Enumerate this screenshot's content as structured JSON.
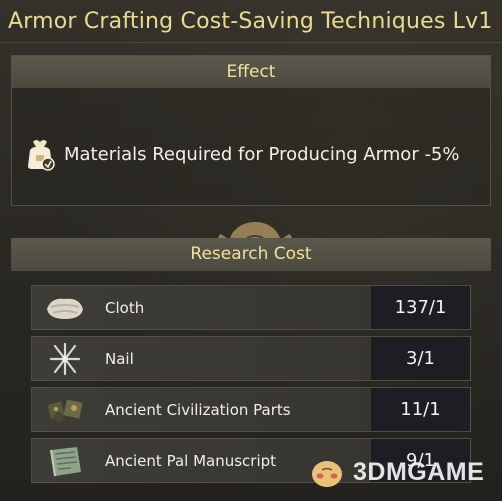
{
  "window": {
    "title": "Armor Crafting Cost-Saving Techniques Lv1"
  },
  "effect": {
    "heading": "Effect",
    "icon": "material-bag-icon",
    "text": "Materials Required for Producing Armor -5%"
  },
  "research_cost": {
    "heading": "Research Cost",
    "items": [
      {
        "icon": "cloth-icon",
        "name": "Cloth",
        "count": "137/1"
      },
      {
        "icon": "nail-icon",
        "name": "Nail",
        "count": "3/1"
      },
      {
        "icon": "ancient-civilization-parts-icon",
        "name": "Ancient Civilization Parts",
        "count": "11/1"
      },
      {
        "icon": "ancient-pal-manuscript-icon",
        "name": "Ancient Pal Manuscript",
        "count": "9/1"
      }
    ]
  },
  "watermark": {
    "text": "3DMGAME"
  },
  "colors": {
    "title": "#e9dc92",
    "section_heading": "#efe39c",
    "count_bg": "#1d1e23"
  }
}
